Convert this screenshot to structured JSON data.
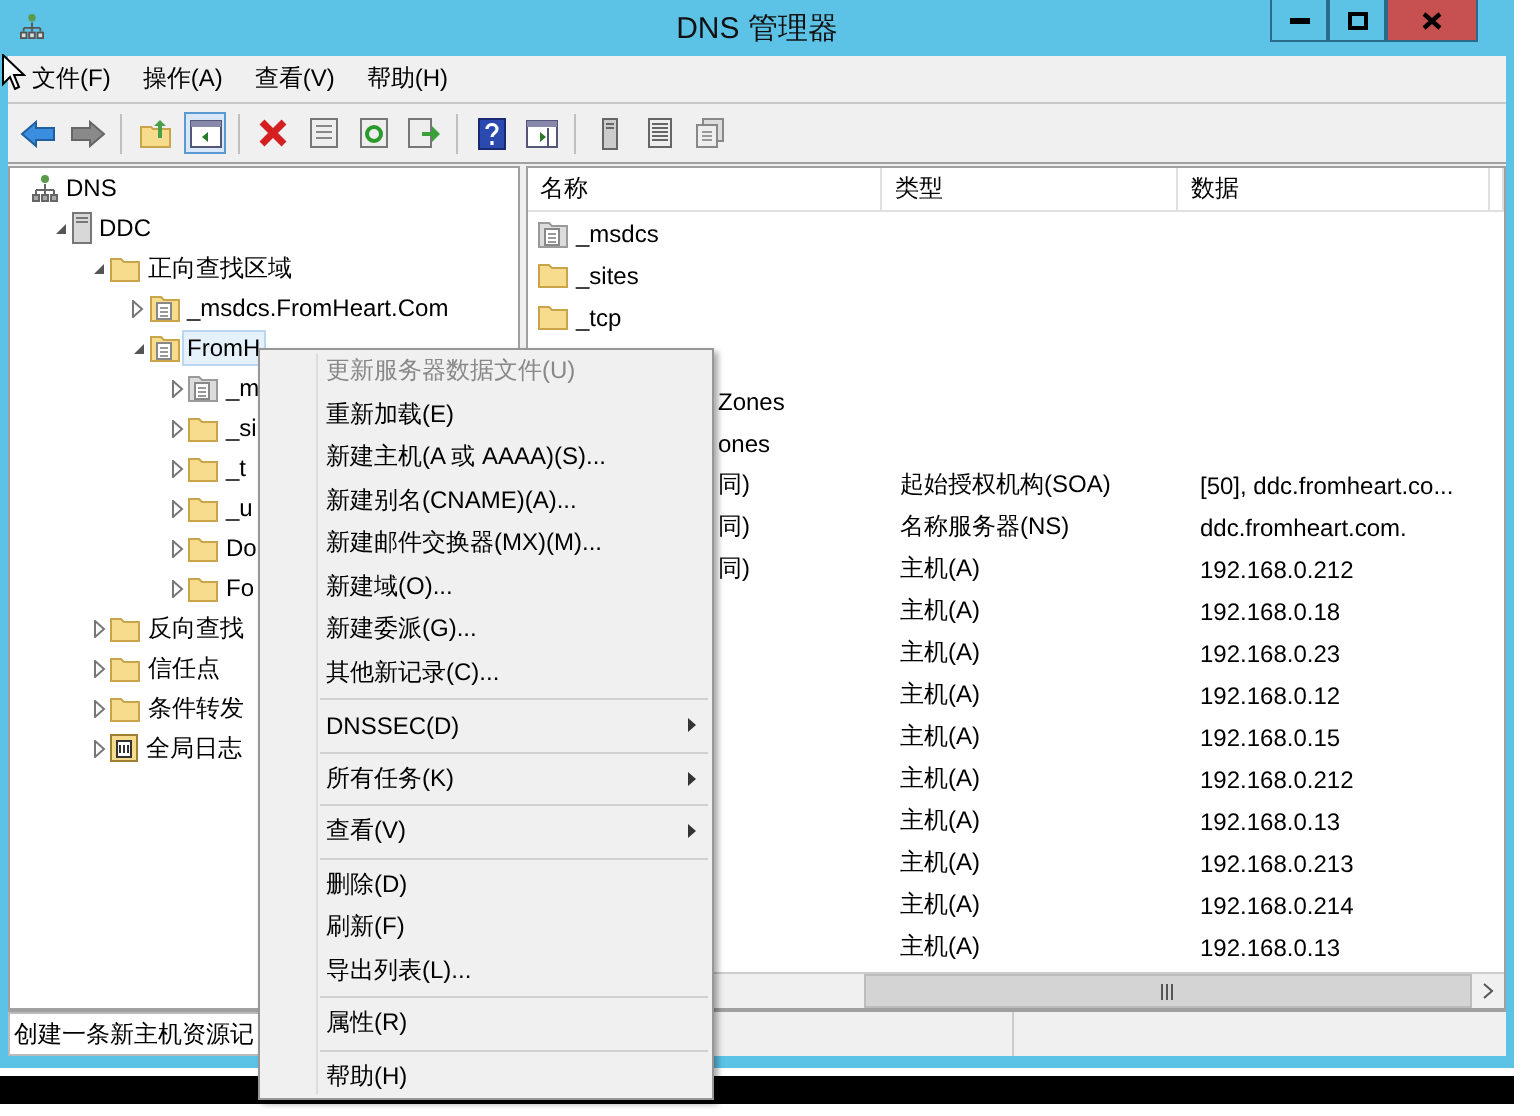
{
  "window": {
    "title": "DNS 管理器"
  },
  "menu_bar": [
    "文件(F)",
    "操作(A)",
    "查看(V)",
    "帮助(H)"
  ],
  "toolbar": {
    "console_tree_pressed": true
  },
  "tree": [
    {
      "label": "DNS",
      "kind": "dns",
      "selected": false,
      "children": [
        {
          "label": "DDC",
          "kind": "server",
          "expanded": true,
          "selected": false,
          "children": [
            {
              "label": "正向查找区域",
              "kind": "folder",
              "expanded": true,
              "selected": false,
              "children": [
                {
                  "label": "_msdcs.FromHeart.Com",
                  "kind": "zone",
                  "expanded": false,
                  "selected": false
                },
                {
                  "label": "FromH",
                  "kind": "zone",
                  "expanded": true,
                  "selected": true,
                  "children": [
                    {
                      "label": "_m",
                      "kind": "zone-gray",
                      "expanded": false,
                      "selected": false
                    },
                    {
                      "label": "_si",
                      "kind": "folder",
                      "expanded": false,
                      "selected": false
                    },
                    {
                      "label": "_t",
                      "kind": "folder",
                      "expanded": false,
                      "selected": false
                    },
                    {
                      "label": "_u",
                      "kind": "folder",
                      "expanded": false,
                      "selected": false
                    },
                    {
                      "label": "Do",
                      "kind": "folder",
                      "expanded": false,
                      "selected": false
                    },
                    {
                      "label": "Fo",
                      "kind": "folder",
                      "expanded": false,
                      "selected": false
                    }
                  ]
                }
              ]
            },
            {
              "label": "反向查找",
              "kind": "folder",
              "expanded": false,
              "selected": false
            },
            {
              "label": "信任点",
              "kind": "folder",
              "expanded": false,
              "selected": false
            },
            {
              "label": "条件转发",
              "kind": "folder",
              "expanded": false,
              "selected": false
            },
            {
              "label": "全局日志",
              "kind": "log",
              "expanded": false,
              "selected": false
            }
          ]
        }
      ]
    }
  ],
  "list": {
    "columns": [
      "名称",
      "类型",
      "数据"
    ],
    "rows": [
      {
        "name": "_msdcs",
        "kind": "zone-gray"
      },
      {
        "name": "_sites",
        "kind": "folder"
      },
      {
        "name": "_tcp",
        "kind": "folder"
      },
      {},
      {
        "name": "Zones",
        "clipped": true
      },
      {
        "name": "ones",
        "clipped": true
      },
      {
        "name": "同)",
        "clipped": true,
        "type": "起始授权机构(SOA)",
        "data": "[50], ddc.fromheart.co..."
      },
      {
        "name": "同)",
        "clipped": true,
        "type": "名称服务器(NS)",
        "data": "ddc.fromheart.com."
      },
      {
        "name": "同)",
        "clipped": true,
        "type": "主机(A)",
        "data": "192.168.0.212"
      },
      {
        "type": "主机(A)",
        "data": "192.168.0.18"
      },
      {
        "type": "主机(A)",
        "data": "192.168.0.23"
      },
      {
        "type": "主机(A)",
        "data": "192.168.0.12"
      },
      {
        "type": "主机(A)",
        "data": "192.168.0.15"
      },
      {
        "type": "主机(A)",
        "data": "192.168.0.212"
      },
      {
        "type": "主机(A)",
        "data": "192.168.0.13"
      },
      {
        "type": "主机(A)",
        "data": "192.168.0.213"
      },
      {
        "type": "主机(A)",
        "data": "192.168.0.214"
      },
      {
        "type": "主机(A)",
        "data": "192.168.0.13"
      }
    ]
  },
  "context_menu": [
    {
      "kind": "item",
      "label": "更新服务器数据文件(U)",
      "disabled": true,
      "submenu": false
    },
    {
      "kind": "item",
      "label": "重新加载(E)",
      "disabled": false,
      "submenu": false
    },
    {
      "kind": "item",
      "label": "新建主机(A 或 AAAA)(S)...",
      "disabled": false,
      "submenu": false
    },
    {
      "kind": "item",
      "label": "新建别名(CNAME)(A)...",
      "disabled": false,
      "submenu": false
    },
    {
      "kind": "item",
      "label": "新建邮件交换器(MX)(M)...",
      "disabled": false,
      "submenu": false
    },
    {
      "kind": "item",
      "label": "新建域(O)...",
      "disabled": false,
      "submenu": false
    },
    {
      "kind": "item",
      "label": "新建委派(G)...",
      "disabled": false,
      "submenu": false
    },
    {
      "kind": "item",
      "label": "其他新记录(C)...",
      "disabled": false,
      "submenu": false
    },
    {
      "kind": "separator"
    },
    {
      "kind": "item",
      "label": "DNSSEC(D)",
      "disabled": false,
      "submenu": true
    },
    {
      "kind": "separator"
    },
    {
      "kind": "item",
      "label": "所有任务(K)",
      "disabled": false,
      "submenu": true
    },
    {
      "kind": "separator"
    },
    {
      "kind": "item",
      "label": "查看(V)",
      "disabled": false,
      "submenu": true
    },
    {
      "kind": "separator"
    },
    {
      "kind": "item",
      "label": "删除(D)",
      "disabled": false,
      "submenu": false
    },
    {
      "kind": "item",
      "label": "刷新(F)",
      "disabled": false,
      "submenu": false
    },
    {
      "kind": "item",
      "label": "导出列表(L)...",
      "disabled": false,
      "submenu": false
    },
    {
      "kind": "separator"
    },
    {
      "kind": "item",
      "label": "属性(R)",
      "disabled": false,
      "submenu": false
    },
    {
      "kind": "separator"
    },
    {
      "kind": "item",
      "label": "帮助(H)",
      "disabled": false,
      "submenu": false
    }
  ],
  "status_bar": {
    "text": "创建一条新主机资源记"
  }
}
